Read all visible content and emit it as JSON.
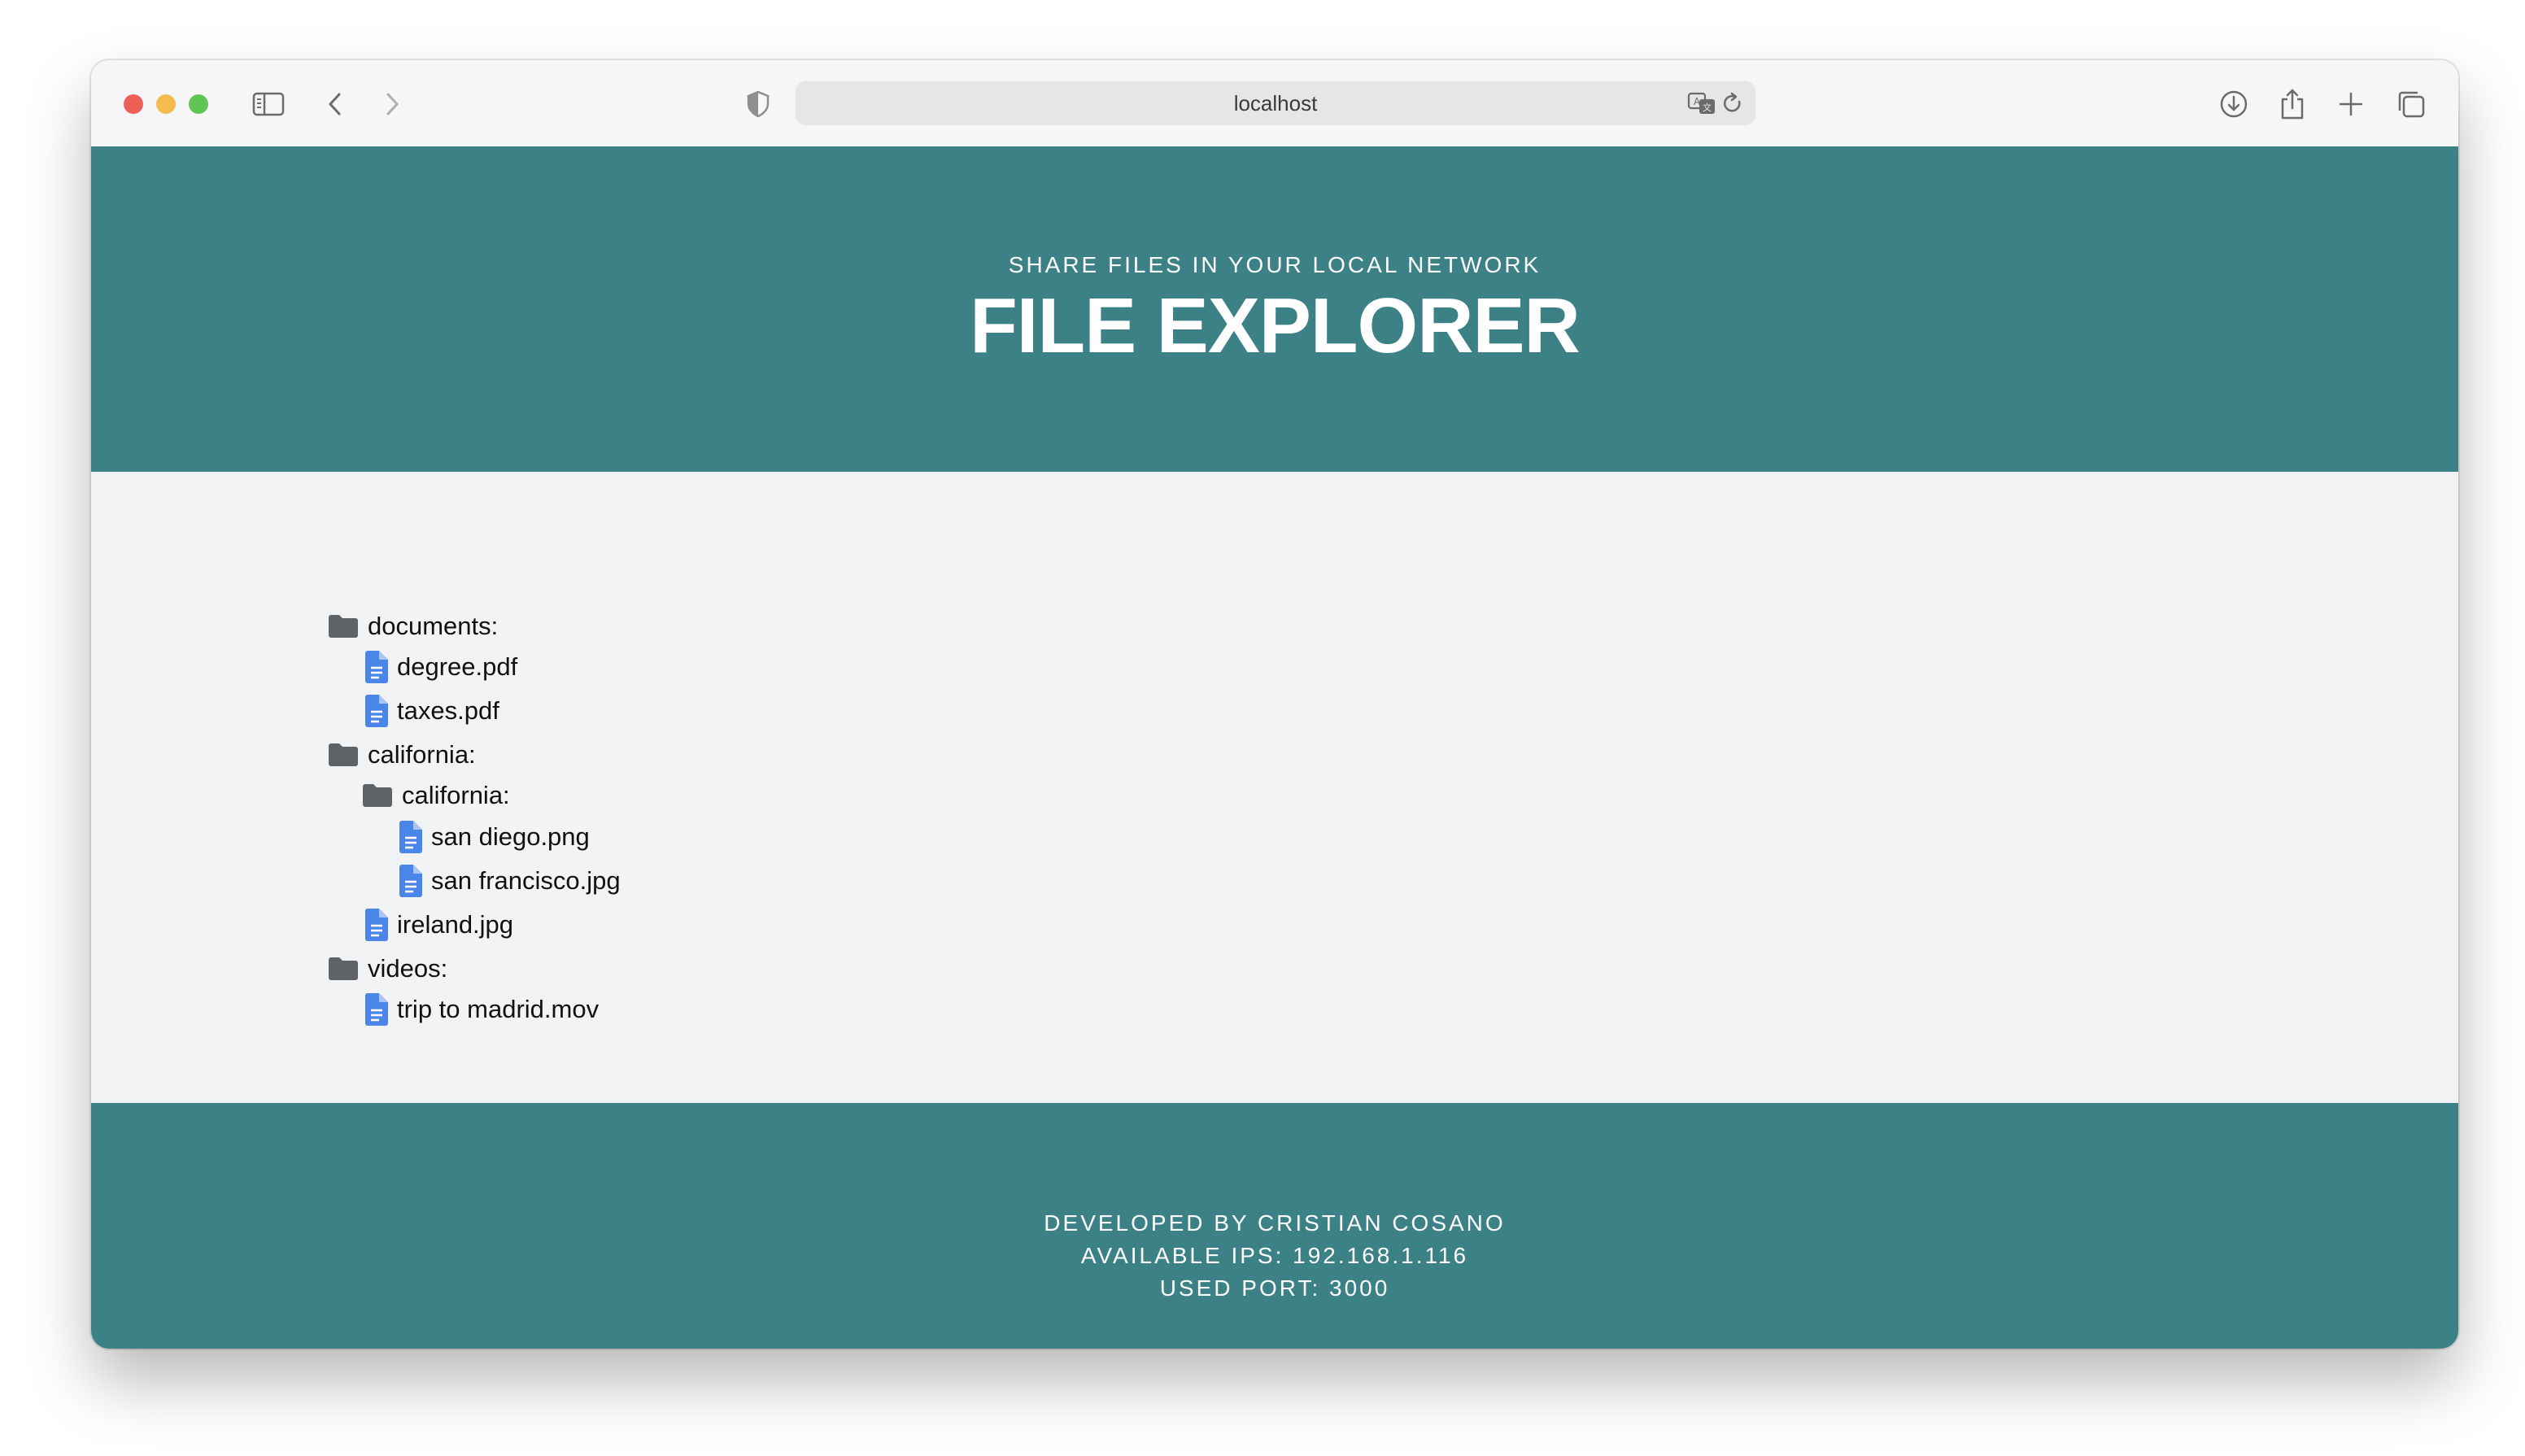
{
  "browser": {
    "url": "localhost"
  },
  "header": {
    "subtitle": "SHARE FILES IN YOUR LOCAL NETWORK",
    "title": "FILE EXPLORER"
  },
  "tree": [
    {
      "type": "folder",
      "label": "documents:",
      "depth": 0
    },
    {
      "type": "file",
      "label": "degree.pdf",
      "depth": 1
    },
    {
      "type": "file",
      "label": "taxes.pdf",
      "depth": 1
    },
    {
      "type": "folder",
      "label": "california:",
      "depth": 0
    },
    {
      "type": "folder",
      "label": "california:",
      "depth": 1
    },
    {
      "type": "file",
      "label": "san diego.png",
      "depth": 2
    },
    {
      "type": "file",
      "label": "san francisco.jpg",
      "depth": 2
    },
    {
      "type": "file",
      "label": "ireland.jpg",
      "depth": 1
    },
    {
      "type": "folder",
      "label": "videos:",
      "depth": 0
    },
    {
      "type": "file",
      "label": "trip to madrid.mov",
      "depth": 1
    }
  ],
  "footer": {
    "developer": "DEVELOPED BY CRISTIAN COSANO",
    "ips": "AVAILABLE IPS: 192.168.1.116",
    "port": "USED PORT: 3000"
  },
  "colors": {
    "accent": "#3c8185",
    "folder_icon": "#5f6368",
    "file_icon": "#4a86e8"
  },
  "icons": {
    "folder": "folder-icon",
    "file": "file-icon"
  }
}
